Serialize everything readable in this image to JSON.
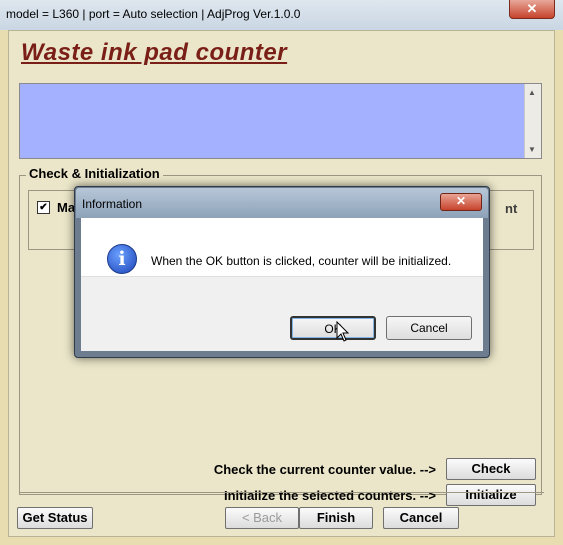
{
  "window": {
    "title": "model = L360 | port = Auto selection | AdjProg Ver.1.0.0",
    "close_symbol": "✕"
  },
  "panel": {
    "title": "Waste ink pad counter"
  },
  "check_group": {
    "label": "Check & Initialization",
    "counter_checkbox_mark": "✔",
    "counter_label_visible": "Ma",
    "counter_label_tail": "nt"
  },
  "actions": {
    "check_label": "Check the current counter value. -->",
    "check_button": "Check",
    "init_label": "Initialize the selected counters. -->",
    "init_button": "Initialize"
  },
  "footer": {
    "get_status": "Get Status",
    "back": "< Back",
    "finish": "Finish",
    "cancel": "Cancel"
  },
  "dialog": {
    "title": "Information",
    "close_symbol": "✕",
    "icon_glyph": "i",
    "message": "When the OK button is clicked, counter will be initialized.",
    "ok": "OK",
    "cancel": "Cancel"
  }
}
